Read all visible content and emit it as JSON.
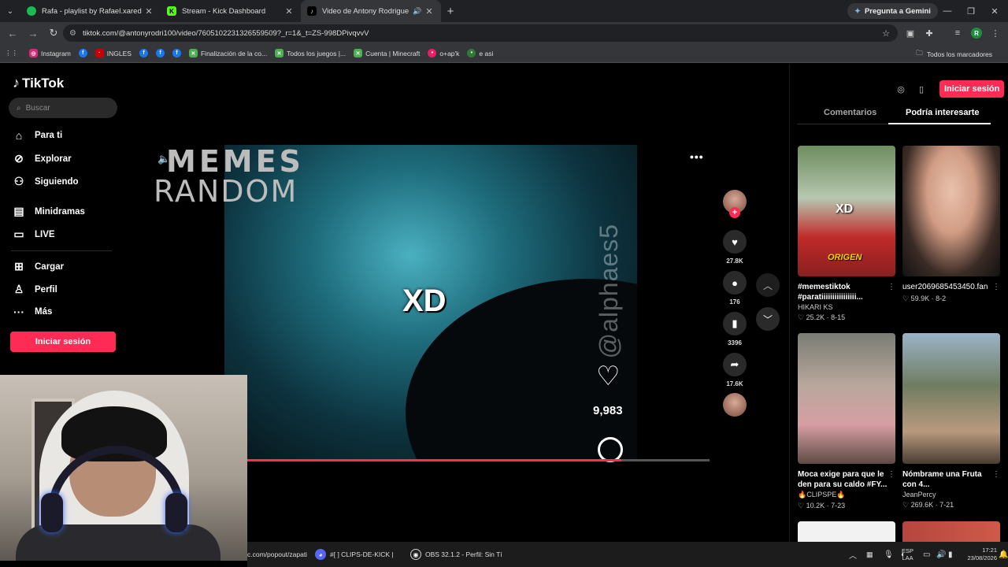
{
  "browser": {
    "tabs": [
      {
        "title": "Rafa - playlist by Rafael.xared |",
        "favicon": "spotify",
        "color": "#1db954"
      },
      {
        "title": "Stream - Kick Dashboard",
        "favicon": "kick",
        "color": "#53fc18"
      },
      {
        "title": "Video de Antony Rodrigue",
        "favicon": "tiktok",
        "color": "#000000",
        "active": true
      }
    ],
    "gemini_label": "Pregunta a Gemini",
    "url": "tiktok.com/@antonyrodri100/video/7605102231326559509?_r=1&_t=ZS-998DPivqvvV",
    "profile_initial": "R",
    "bookmarks": [
      {
        "label": "Instagram",
        "color": "#d62976"
      },
      {
        "label": "",
        "color": "#1877f2"
      },
      {
        "label": "INGLES",
        "color": "#c00"
      },
      {
        "label": "",
        "color": "#1877f2"
      },
      {
        "label": "",
        "color": "#1877f2"
      },
      {
        "label": "",
        "color": "#1877f2"
      },
      {
        "label": "Finalización de la co...",
        "color": "#4caf50"
      },
      {
        "label": "Todos los juegos |...",
        "color": "#4caf50"
      },
      {
        "label": "Cuenta | Minecraft",
        "color": "#4caf50"
      },
      {
        "label": "o+ap'k",
        "color": "#e91e63"
      },
      {
        "label": "e asi",
        "color": "#2e7d32"
      }
    ],
    "all_bookmarks": "Todos los marcadores"
  },
  "tiktok": {
    "logo": "TikTok",
    "search_placeholder": "Buscar",
    "nav": [
      {
        "label": "Para ti",
        "icon": "home-icon"
      },
      {
        "label": "Explorar",
        "icon": "compass-icon"
      },
      {
        "label": "Siguiendo",
        "icon": "following-icon"
      },
      {
        "label": "Minidramas",
        "icon": "minidramas-icon"
      },
      {
        "label": "LIVE",
        "icon": "live-icon"
      },
      {
        "label": "Cargar",
        "icon": "upload-icon"
      },
      {
        "label": "Perfil",
        "icon": "profile-icon"
      },
      {
        "label": "Más",
        "icon": "more-icon"
      }
    ],
    "login_label": "Iniciar sesión",
    "overlay_title_1": "MEMES",
    "overlay_title_2": "RANDOM",
    "video_caption": "XD",
    "video_watermark": "@alphaes5",
    "video_like_count": "9,983",
    "progress": 0.81,
    "actions": {
      "likes": "27.8K",
      "comments": "176",
      "saves": "3396",
      "shares": "17.6K"
    },
    "right_tabs": [
      "Comentarios",
      "Podría interesarte"
    ],
    "cards": [
      {
        "title1": "#memestiktok",
        "title2": "#paratіііііііііііііііі...",
        "author": "HIKARI KS",
        "likes": "25.2K",
        "date": "8-15",
        "overlay": "XD",
        "overlay2": "ORIGEN"
      },
      {
        "title1": "user2069685453450.fan",
        "title2": "",
        "author": "",
        "likes": "59.9K",
        "date": "8-2",
        "overlay": "",
        "overlay2": ""
      },
      {
        "title1": "Moca exige para que le",
        "title2": "den para su caldo #FY...",
        "author": "CLIPSPE",
        "likes": "10.2K",
        "date": "7-23",
        "overlay": "",
        "overlay2": ""
      },
      {
        "title1": "Nómbrame una Fruta",
        "title2": "con 4...",
        "author": "JeanPercy",
        "likes": "269.6K",
        "date": "7-21",
        "overlay": "",
        "overlay2": ""
      }
    ]
  },
  "taskbar": {
    "items": [
      "c.com/popout/zapati",
      "#[ ] CLIPS-DE-KICK |",
      "OBS 32.1.2 - Perfil: Sin Tí"
    ],
    "lang1": "ESP",
    "lang2": "LAA",
    "time": "17:21",
    "date": "23/08/2026"
  }
}
